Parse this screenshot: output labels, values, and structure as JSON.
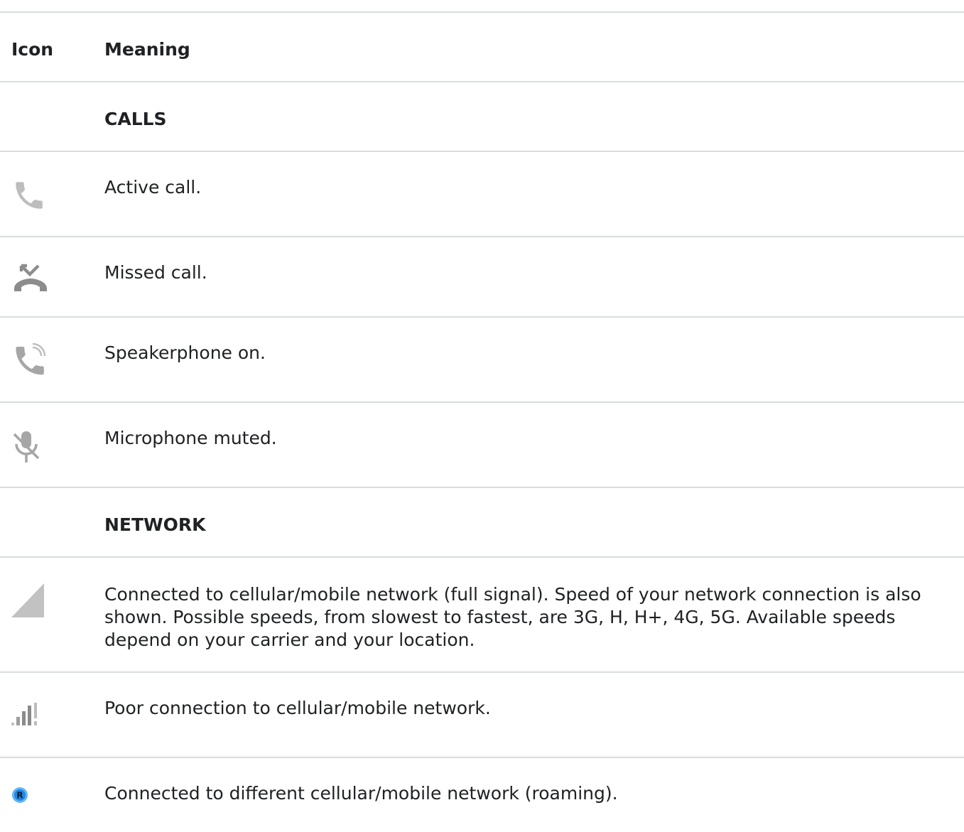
{
  "header": {
    "icon_col": "Icon",
    "meaning_col": "Meaning"
  },
  "sections": {
    "calls": "CALLS",
    "network": "NETWORK"
  },
  "rows": {
    "active_call": {
      "icon": "phone-icon",
      "text": "Active call."
    },
    "missed_call": {
      "icon": "missed-call-icon",
      "text": "Missed call."
    },
    "speakerphone": {
      "icon": "speakerphone-icon",
      "text": "Speakerphone on."
    },
    "mic_muted": {
      "icon": "mic-muted-icon",
      "text": "Microphone muted."
    },
    "cellular_full": {
      "icon": "signal-full-icon",
      "text": "Connected to cellular/mobile network (full signal). Speed of your network connection is also shown. Possible speeds, from slowest to fastest, are 3G, H, H+, 4G, 5G. Available speeds depend on your carrier and your location."
    },
    "poor_connection": {
      "icon": "signal-poor-icon",
      "text": "Poor connection to cellular/mobile network."
    },
    "roaming": {
      "icon": "roaming-icon",
      "text": "Connected to different cellular/mobile network (roaming)."
    }
  },
  "colors": {
    "icon_gray": "#9e9e9e",
    "divider": "#dadce0",
    "roaming_blue": "#1e88e5"
  }
}
